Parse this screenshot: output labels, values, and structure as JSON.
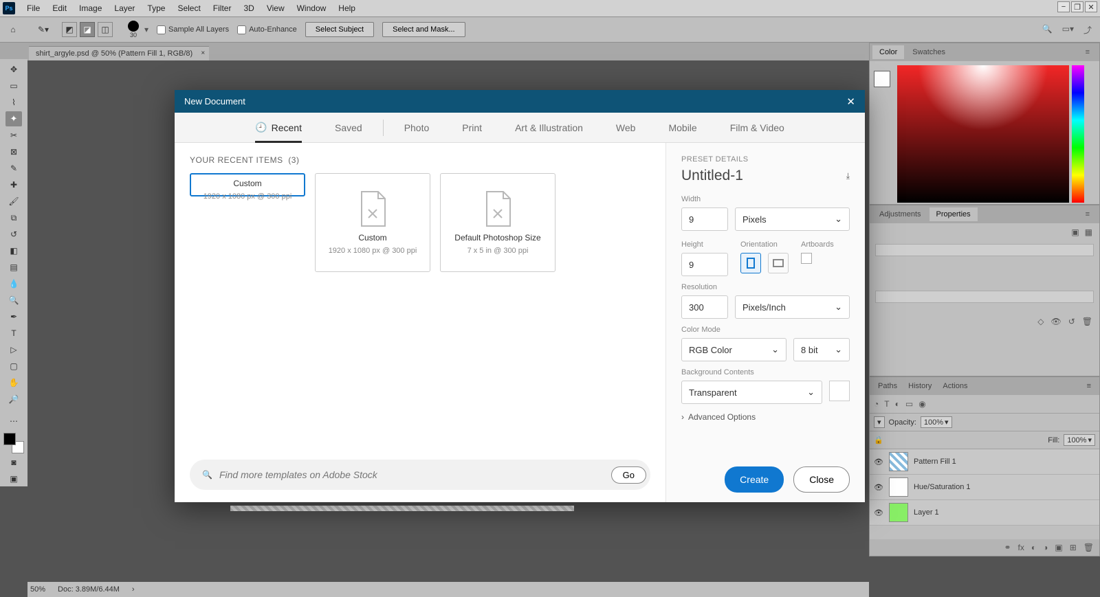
{
  "menu": [
    "File",
    "Edit",
    "Image",
    "Layer",
    "Type",
    "Select",
    "Filter",
    "3D",
    "View",
    "Window",
    "Help"
  ],
  "brush_size": "30",
  "opt_sample": "Sample All Layers",
  "opt_auto": "Auto-Enhance",
  "opt_selsubj": "Select Subject",
  "opt_selmask": "Select and Mask...",
  "doc_tab": "shirt_argyle.psd @ 50% (Pattern Fill 1, RGB/8)",
  "panels": {
    "color": "Color",
    "swatches": "Swatches",
    "adjust": "Adjustments",
    "props": "Properties",
    "paths": "Paths",
    "history": "History",
    "actions": "Actions",
    "opacity_lbl": "Opacity:",
    "fill_lbl": "Fill:",
    "opacity_val": "100%",
    "fill_val": "100%"
  },
  "layers": [
    "Pattern Fill 1",
    "Hue/Saturation 1",
    "Layer 1"
  ],
  "status": {
    "zoom": "50%",
    "doc": "Doc: 3.89M/6.44M"
  },
  "modal": {
    "title": "New Document",
    "tabs": [
      "Recent",
      "Saved",
      "Photo",
      "Print",
      "Art & Illustration",
      "Web",
      "Mobile",
      "Film & Video"
    ],
    "recents_hdr": "YOUR RECENT ITEMS",
    "recents_count": "(3)",
    "cards": [
      {
        "name": "Custom",
        "sub": "1920 x 1080 px @ 300 ppi"
      },
      {
        "name": "Custom",
        "sub": "1920 x 1080 px @ 300 ppi"
      },
      {
        "name": "Default Photoshop Size",
        "sub": "7 x 5 in @ 300 ppi"
      }
    ],
    "search_ph": "Find more templates on Adobe Stock",
    "go": "Go",
    "preset": {
      "hdr": "PRESET DETAILS",
      "name": "Untitled-1",
      "width_lbl": "Width",
      "width": "9",
      "width_unit": "Pixels",
      "height_lbl": "Height",
      "height": "9",
      "orient_lbl": "Orientation",
      "art_lbl": "Artboards",
      "res_lbl": "Resolution",
      "res": "300",
      "res_unit": "Pixels/Inch",
      "cmode_lbl": "Color Mode",
      "cmode": "RGB Color",
      "cdepth": "8 bit",
      "bg_lbl": "Background Contents",
      "bg": "Transparent",
      "adv": "Advanced Options",
      "create": "Create",
      "close": "Close"
    }
  }
}
